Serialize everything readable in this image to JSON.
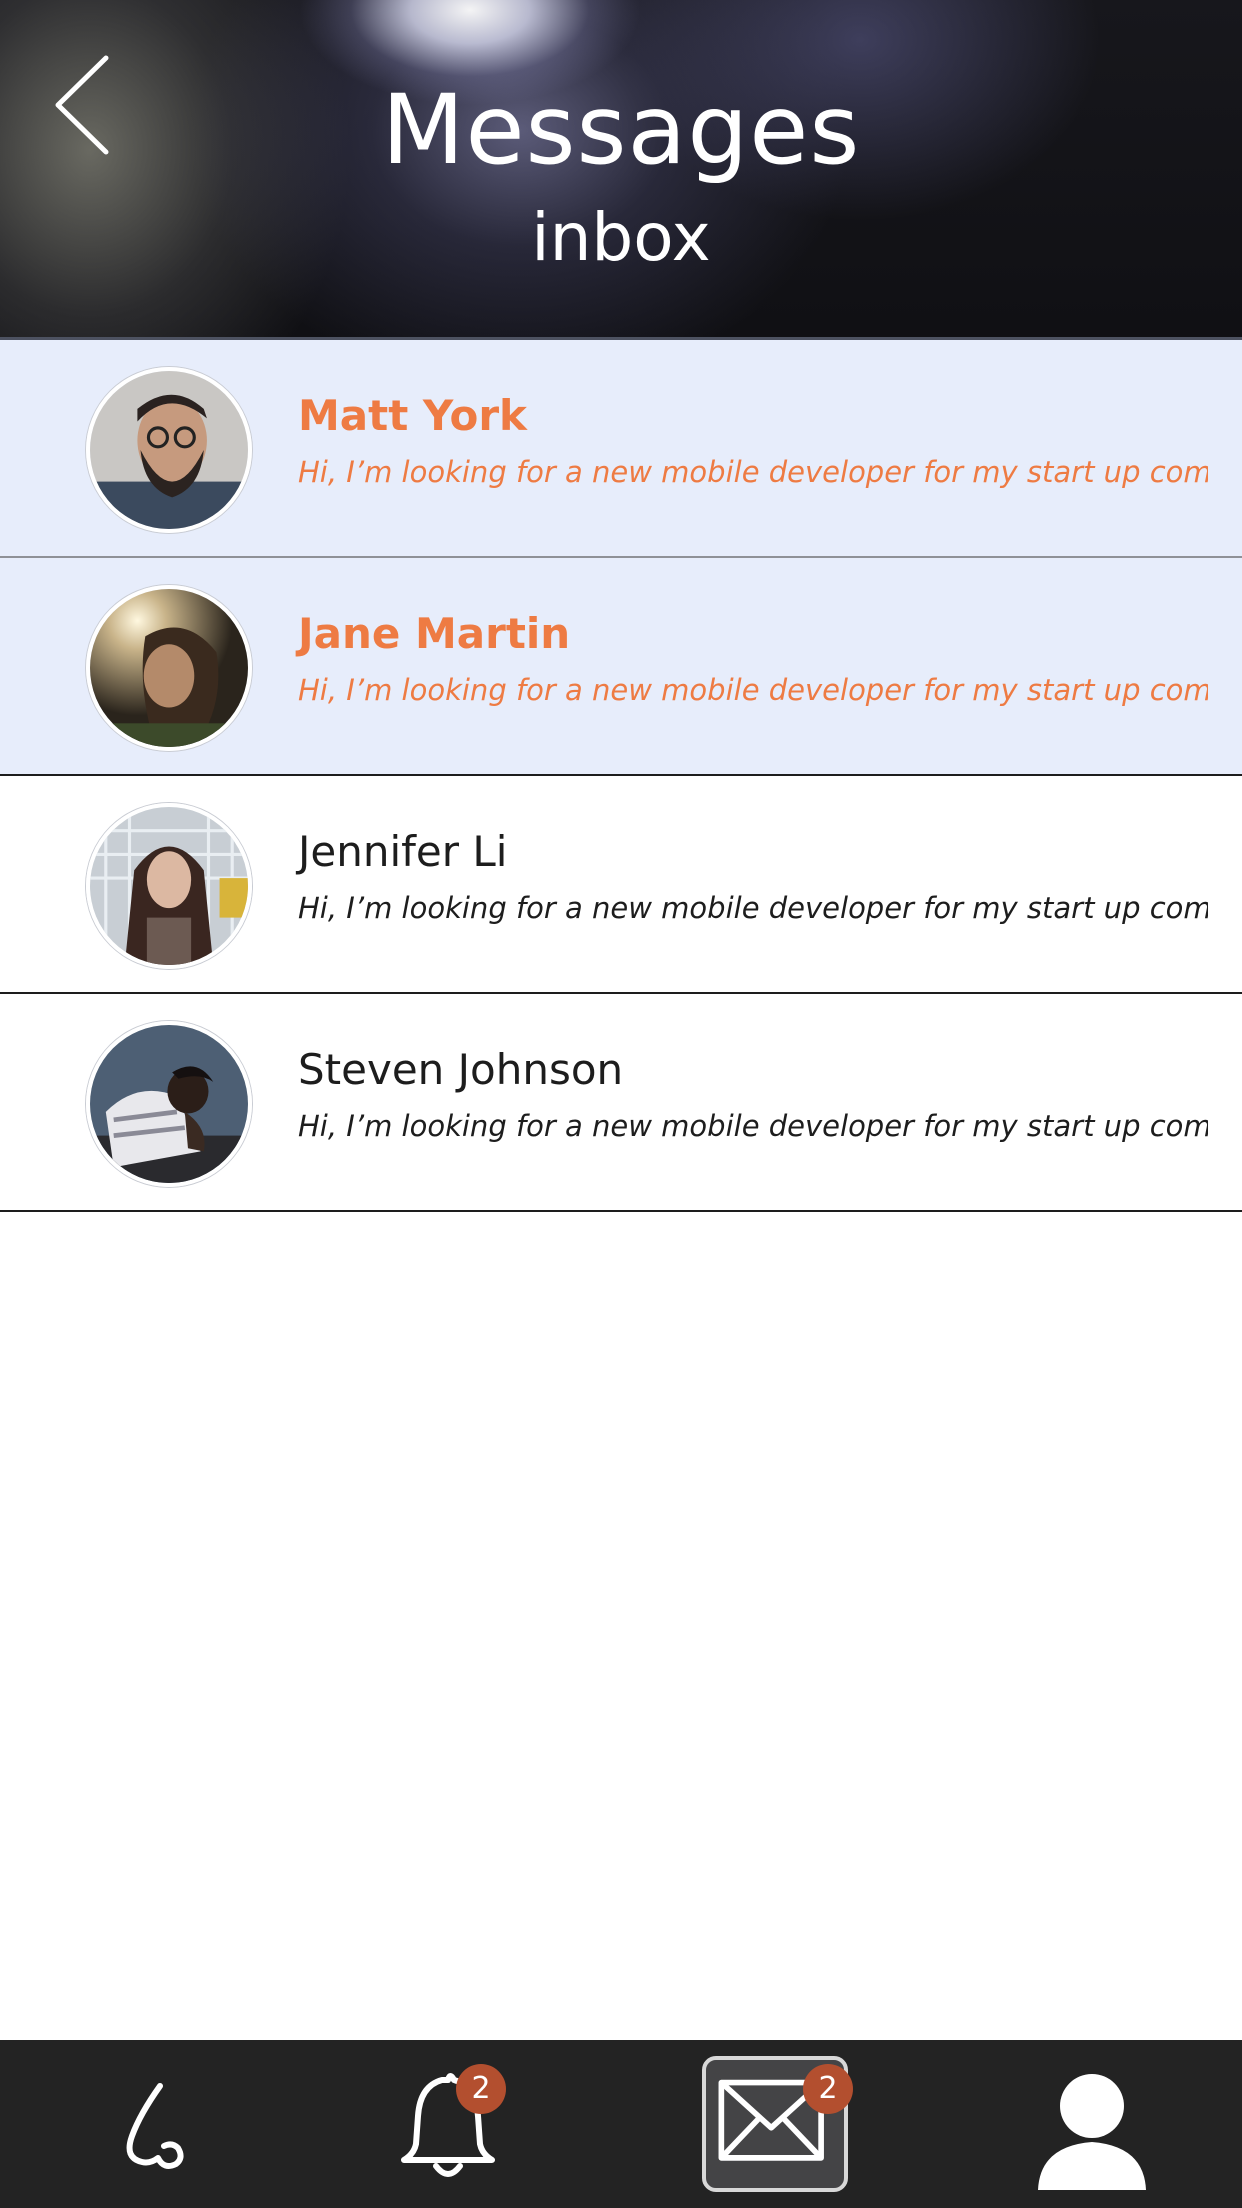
{
  "header": {
    "title": "Messages",
    "subtitle": "inbox",
    "back_icon": "chevron-left-icon"
  },
  "colors": {
    "accent_unread": "#ee7b43",
    "unread_row_background": "#e7edfb",
    "tab_bar_background": "#232323",
    "badge_background": "#b34f2f"
  },
  "messages": [
    {
      "name": "Matt York",
      "preview": "Hi, I’m looking for a new mobile developer for my start up company...",
      "unread": true,
      "avatar": "avatar-photo"
    },
    {
      "name": "Jane Martin",
      "preview": "Hi, I’m looking for a new mobile developer for my start up company...",
      "unread": true,
      "avatar": "avatar-photo"
    },
    {
      "name": "Jennifer Li",
      "preview": "Hi, I’m looking for a new mobile developer for my start up company...",
      "unread": false,
      "avatar": "avatar-photo"
    },
    {
      "name": "Steven Johnson",
      "preview": "Hi, I’m looking for a new mobile developer for my start up company...",
      "unread": false,
      "avatar": "avatar-photo"
    }
  ],
  "tabbar": {
    "items": [
      {
        "icon": "nose-icon",
        "badge": null,
        "active": false
      },
      {
        "icon": "bell-icon",
        "badge": "2",
        "active": false
      },
      {
        "icon": "envelope-icon",
        "badge": "2",
        "active": true
      },
      {
        "icon": "user-icon",
        "badge": null,
        "active": false
      }
    ]
  }
}
